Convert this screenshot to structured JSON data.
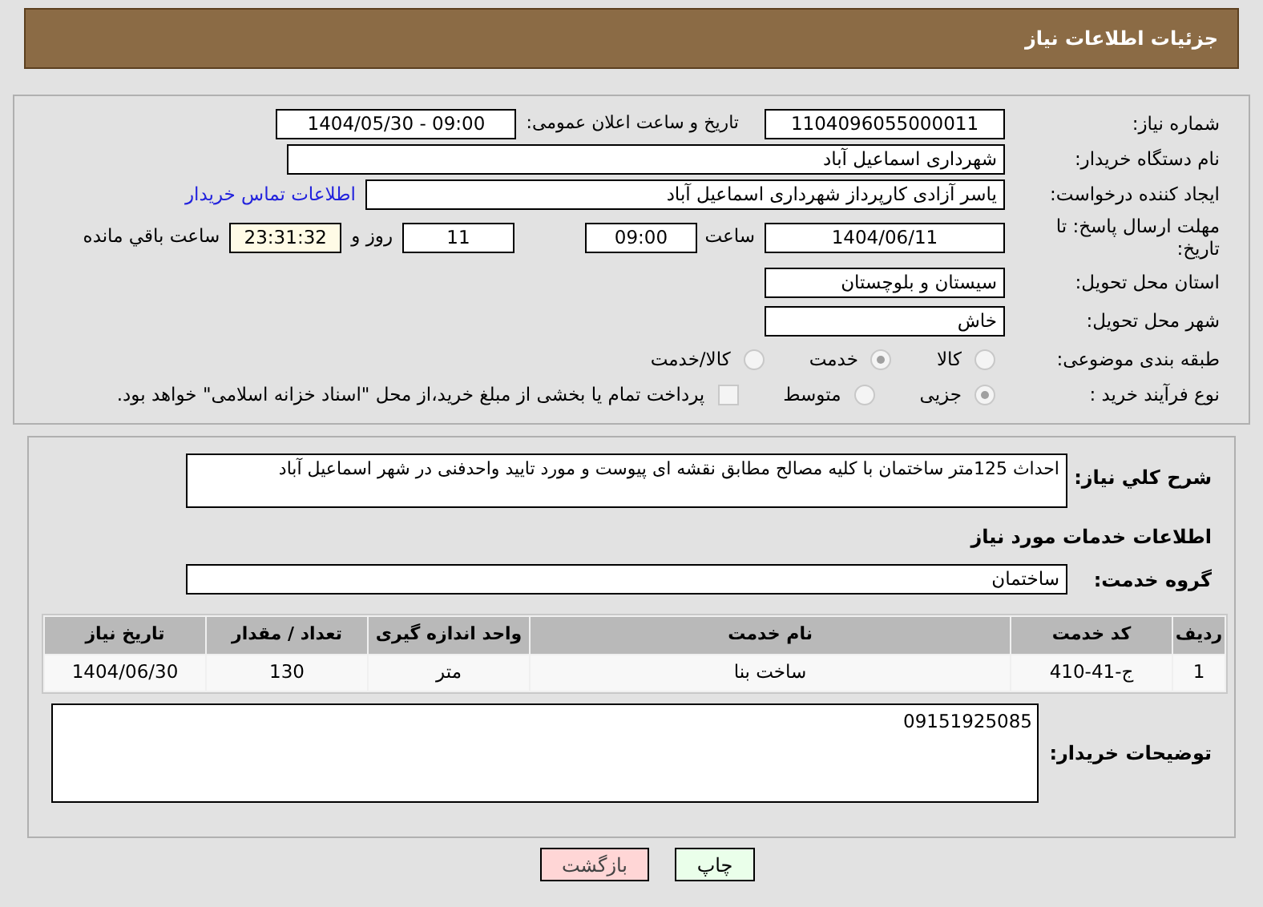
{
  "header": {
    "title": "جزئیات اطلاعات نیاز"
  },
  "need_number": {
    "label": "شماره نیاز:",
    "value": "1104096055000011"
  },
  "announce": {
    "label": "تاریخ و ساعت اعلان عمومی:",
    "value": "1404/05/30 - 09:00"
  },
  "buyer_org": {
    "label": "نام دستگاه خریدار:",
    "value": "شهرداری اسماعیل آباد"
  },
  "requester": {
    "label": "ایجاد کننده درخواست:",
    "value": "یاسر آزادی کارپرداز شهرداری اسماعیل آباد"
  },
  "contact_link": "اطلاعات تماس خریدار",
  "deadline": {
    "label": "مهلت ارسال پاسخ: تا تاریخ:",
    "date": "1404/06/11",
    "time_label": "ساعت",
    "time": "09:00",
    "days": "11",
    "days_label": "روز و",
    "remaining": "23:31:32",
    "remaining_label": "ساعت باقي مانده"
  },
  "province": {
    "label": "استان محل تحویل:",
    "value": "سیستان و بلوچستان"
  },
  "city": {
    "label": "شهر محل تحویل:",
    "value": "خاش"
  },
  "category": {
    "label": "طبقه بندی موضوعی:",
    "options": [
      {
        "label": "کالا",
        "selected": false
      },
      {
        "label": "خدمت",
        "selected": true
      },
      {
        "label": "کالا/خدمت",
        "selected": false
      }
    ]
  },
  "purchase_type": {
    "label": "نوع فرآیند خرید :",
    "options": [
      {
        "label": "جزیی",
        "selected": true
      },
      {
        "label": "متوسط",
        "selected": false
      }
    ],
    "checkbox": {
      "label": "پرداخت تمام یا بخشی از مبلغ خرید،از محل \"اسناد خزانه اسلامی\" خواهد بود.",
      "checked": false
    }
  },
  "description": {
    "label": "شرح کلي نیاز:",
    "value": "احداث 125متر ساختمان با کلیه مصالح مطابق نقشه ای پیوست و مورد تایید واحدفنی در شهر اسماعیل آباد"
  },
  "services_title": "اطلاعات خدمات مورد نیاز",
  "service_group": {
    "label": "گروه خدمت:",
    "value": "ساختمان"
  },
  "table": {
    "columns": [
      "ردیف",
      "کد خدمت",
      "نام خدمت",
      "واحد اندازه گیری",
      "تعداد / مقدار",
      "تاریخ نیاز"
    ],
    "rows": [
      [
        "1",
        "ج-41-410",
        "ساخت بنا",
        "متر",
        "130",
        "1404/06/30"
      ]
    ]
  },
  "buyer_notes": {
    "label": "توضیحات خریدار:",
    "value": "09151925085"
  },
  "buttons": [
    {
      "label": "چاپ",
      "kind": "print"
    },
    {
      "label": "بازگشت",
      "kind": "back"
    }
  ]
}
